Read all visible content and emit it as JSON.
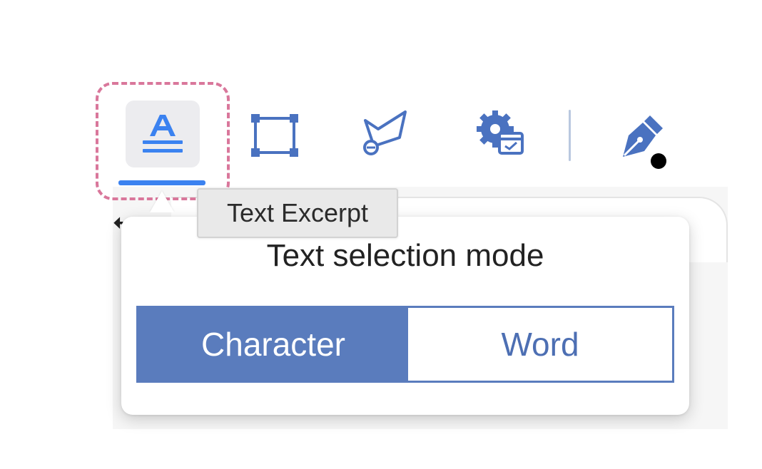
{
  "toolbar": {
    "tools": [
      {
        "icon": "text-excerpt-icon",
        "active": true
      },
      {
        "icon": "rectangle-select-icon"
      },
      {
        "icon": "region-select-icon"
      },
      {
        "icon": "settings-screen-icon"
      },
      {
        "icon": "pen-icon"
      }
    ]
  },
  "tooltip": {
    "text": "Text Excerpt"
  },
  "popover": {
    "title": "Text selection mode",
    "options": [
      {
        "label": "Character",
        "selected": true
      },
      {
        "label": "Word",
        "selected": false
      }
    ]
  },
  "colors": {
    "accent": "#5a7cbd",
    "active_underline": "#3b82f0",
    "focus_ring": "#d9779b",
    "icon_blue": "#4a72c0"
  }
}
